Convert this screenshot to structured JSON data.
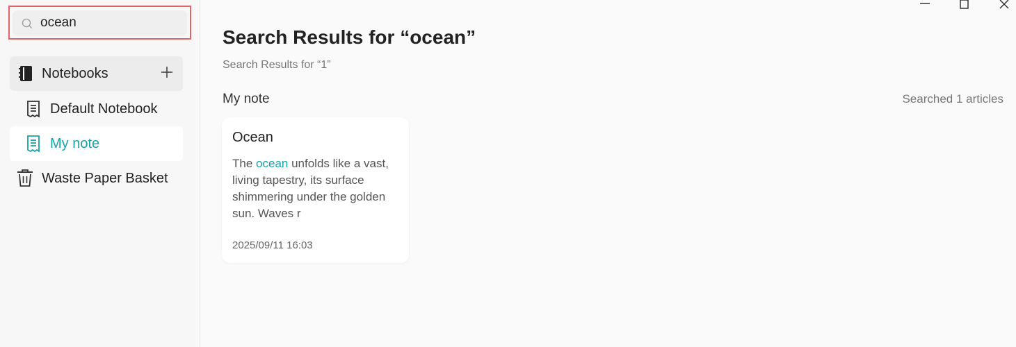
{
  "search": {
    "value": "ocean",
    "placeholder": ""
  },
  "sidebar": {
    "notebooks_label": "Notebooks",
    "items": [
      {
        "label": "Default Notebook",
        "icon": "notebook-icon"
      },
      {
        "label": "My note",
        "icon": "notebook-icon",
        "active": true
      }
    ],
    "trash_label": "Waste Paper Basket"
  },
  "main": {
    "title": "Search Results for “ocean”",
    "subtitle": "Search Results for “1”",
    "section_label": "My note",
    "searched_count": "Searched 1 articles",
    "results": [
      {
        "title": "Ocean",
        "body_before": "The ",
        "body_highlight": "ocean",
        "body_after": " unfolds like a vast, living tapestry, its surface shimmering under the golden sun. Waves r",
        "date": "2025/09/11 16:03"
      }
    ]
  },
  "colors": {
    "accent": "#16a3a8",
    "highlight_border": "#e06666"
  }
}
